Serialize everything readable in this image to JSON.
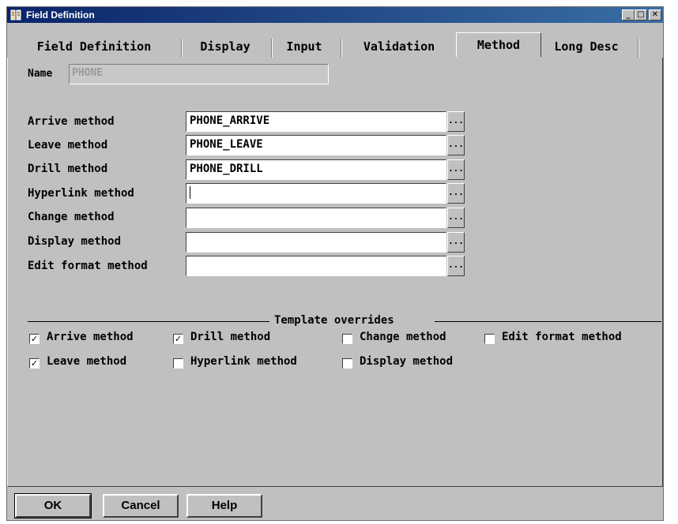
{
  "window": {
    "title": "Field Definition",
    "icon": "book-icon",
    "controls": {
      "minimize": "_",
      "maximize": "□",
      "close": "✕"
    }
  },
  "tabs": [
    {
      "label": "Field Definition",
      "active": false
    },
    {
      "label": "Display",
      "active": false
    },
    {
      "label": "Input",
      "active": false
    },
    {
      "label": "Validation",
      "active": false
    },
    {
      "label": "Method",
      "active": true
    },
    {
      "label": "Long Desc",
      "active": false
    }
  ],
  "name": {
    "label": "Name",
    "value": "PHONE"
  },
  "methods": [
    {
      "label": "Arrive method",
      "value": "PHONE_ARRIVE"
    },
    {
      "label": "Leave method",
      "value": "PHONE_LEAVE"
    },
    {
      "label": "Drill method",
      "value": "PHONE_DRILL"
    },
    {
      "label": "Hyperlink method",
      "value": ""
    },
    {
      "label": "Change method",
      "value": ""
    },
    {
      "label": "Display method",
      "value": ""
    },
    {
      "label": "Edit format method",
      "value": ""
    }
  ],
  "browse_label": "...",
  "overrides": {
    "title": "Template overrides",
    "items": [
      {
        "label": "Arrive method",
        "checked": true
      },
      {
        "label": "Drill method",
        "checked": true
      },
      {
        "label": "Change method",
        "checked": false
      },
      {
        "label": "Edit format method",
        "checked": false
      },
      {
        "label": "Leave method",
        "checked": true
      },
      {
        "label": "Hyperlink method",
        "checked": false
      },
      {
        "label": "Display method",
        "checked": false
      }
    ]
  },
  "buttons": {
    "ok": "OK",
    "cancel": "Cancel",
    "help": "Help"
  },
  "colors": {
    "titlebar": "#0a246a",
    "face": "#c0c0c0"
  }
}
